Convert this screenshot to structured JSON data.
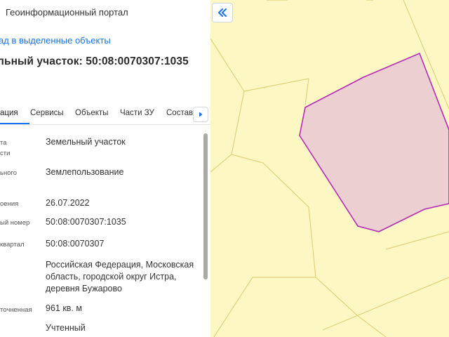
{
  "header": {
    "portal_title": "Геоинформационный портал"
  },
  "back_link": "ад в выделенные объекты",
  "parcel_title": "льный участок: 50:08:0070307:1035",
  "tabs": [
    {
      "label": "ация",
      "active": true
    },
    {
      "label": "Сервисы",
      "active": false
    },
    {
      "label": "Объекты",
      "active": false
    },
    {
      "label": "Части ЗУ",
      "active": false
    },
    {
      "label": "Состав",
      "active": false
    }
  ],
  "tab_next_icon": "caret-right-icon",
  "properties": [
    {
      "label_lines": [
        "та",
        "сти"
      ],
      "value": "Земельный участок"
    },
    {
      "label_lines": [
        "ьного"
      ],
      "value": "Землепользование"
    },
    {
      "label_lines": [
        "оения"
      ],
      "value": "26.07.2022"
    },
    {
      "label_lines": [
        "ый номер"
      ],
      "value": "50:08:0070307:1035"
    },
    {
      "label_lines": [
        "квартал"
      ],
      "value": "50:08:0070307"
    },
    {
      "label_lines": [
        ""
      ],
      "value": "Российская Федерация, Московская область, городской округ Истра, деревня Бужарово"
    },
    {
      "label_lines": [
        "точненная"
      ],
      "value": "961 кв. м"
    },
    {
      "label_lines": [
        ""
      ],
      "value": "Учтенный"
    }
  ],
  "map": {
    "collapse_icon": "double-chevron-left-icon",
    "background_color": "#fdf8c3",
    "parcel_fill": "#ebcfd1",
    "parcel_stroke": "#b32bb8",
    "boundary_color": "#e0d27a",
    "watermark_icon": "cian-watermark-icon"
  },
  "colors": {
    "accent": "#1a73e8"
  }
}
